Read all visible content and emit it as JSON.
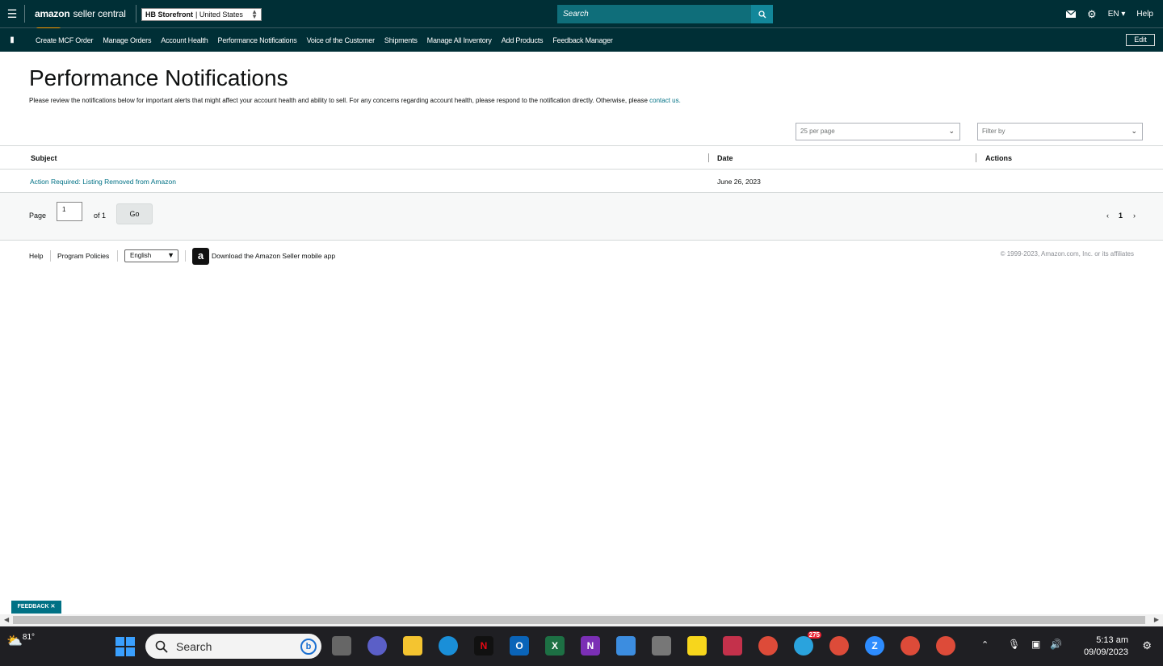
{
  "header": {
    "brand": "amazon",
    "brand_suffix": "seller central",
    "store_bold": "HB Storefront",
    "store_rest": "| United States",
    "search_placeholder": "Search",
    "lang": "EN",
    "help": "Help"
  },
  "nav": {
    "items": [
      "Create MCF Order",
      "Manage Orders",
      "Account Health",
      "Performance Notifications",
      "Voice of the Customer",
      "Shipments",
      "Manage All Inventory",
      "Add Products",
      "Feedback Manager"
    ],
    "edit": "Edit"
  },
  "page": {
    "title": "Performance Notifications",
    "subtitle": "Please review the notifications below for important alerts that might affect your account health and ability to sell. For any concerns regarding account health, please respond to the notification directly. Otherwise, please",
    "contact_link": "contact us."
  },
  "filters": {
    "per_page": "25 per page",
    "filter_by": "Filter by"
  },
  "table": {
    "headers": [
      "Subject",
      "Date",
      "Actions"
    ],
    "rows": [
      {
        "subject": "Action Required: Listing Removed from Amazon",
        "date": "June 26, 2023",
        "actions": ""
      }
    ]
  },
  "pagination": {
    "page_label": "Page",
    "page_value": "1",
    "of_label": "of 1",
    "go": "Go",
    "current": "1"
  },
  "footer": {
    "help": "Help",
    "policies": "Program Policies",
    "language": "English",
    "app_text": "Download the Amazon Seller mobile app",
    "copyright": "© 1999-2023, Amazon.com, Inc. or its affiliates"
  },
  "feedback": "FEEDBACK",
  "taskbar": {
    "temp": "81°",
    "search": "Search",
    "telegram_badge": "275",
    "time": "5:13 am",
    "date": "09/09/2023"
  }
}
